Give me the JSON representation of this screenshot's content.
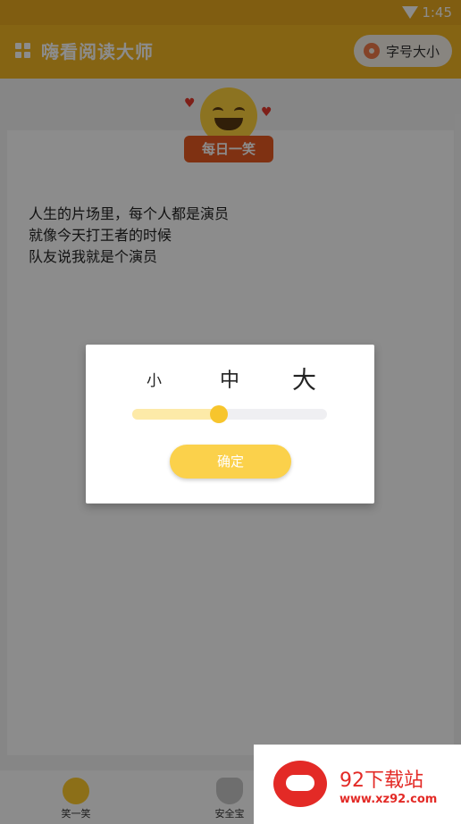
{
  "status_bar": {
    "time": "1:45",
    "wifi_icon": "wifi-icon"
  },
  "app_bar": {
    "title": "嗨看阅读大师",
    "font_size_button": "字号大小",
    "menu_icon": "grid-icon",
    "font_icon": "flower-gear-icon"
  },
  "badge": {
    "label": "每日一笑",
    "icon": "smiley-icon"
  },
  "joke": {
    "lines": [
      "人生的片场里，每个人都是演员",
      "就像今天打王者的时候",
      "队友说我就是个演员"
    ]
  },
  "dialog": {
    "options": [
      "小",
      "中",
      "大"
    ],
    "slider_value": 0.4,
    "confirm_label": "确定"
  },
  "tabbar": {
    "tabs": [
      {
        "label": "笑一笑",
        "icon": "smiley-tab-icon"
      },
      {
        "label": "安全宝",
        "icon": "shield-icon"
      }
    ]
  },
  "watermark": {
    "name": "92下载站",
    "url": "www.xz92.com"
  },
  "colors": {
    "accent": "#f2b623",
    "dialog_button": "#fbd14b",
    "badge": "#e85a22"
  }
}
